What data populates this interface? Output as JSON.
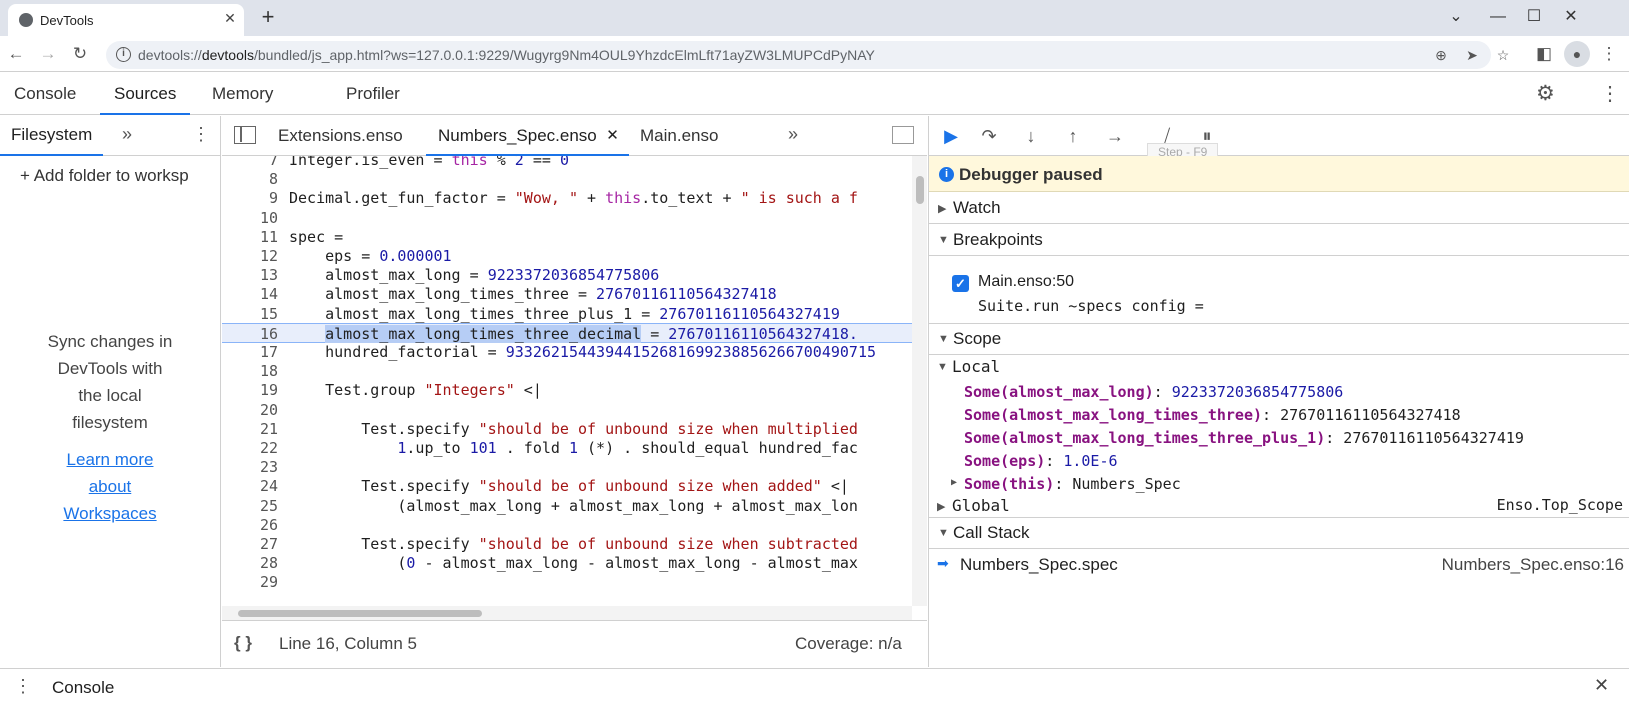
{
  "browser": {
    "tab_title": "DevTools",
    "url_scheme": "devtools://",
    "url_host": "devtools",
    "url_path": "/bundled/js_app.html?ws=127.0.0.1:9229/Wugyrg9Nm4OUL9YhzdcElmLft71ayZW3LMUPCdPyNAY"
  },
  "devtools_tabs": [
    "Console",
    "Sources",
    "Memory",
    "Profiler"
  ],
  "navigator": {
    "tab": "Filesystem",
    "add_folder": "Add folder to worksp",
    "sync_text": [
      "Sync changes in",
      "DevTools with",
      "the local",
      "filesystem"
    ],
    "learn_more": [
      "Learn more",
      "about",
      "Workspaces"
    ]
  },
  "editor": {
    "tabs": [
      "Extensions.enso",
      "Numbers_Spec.enso",
      "Main.enso"
    ],
    "status_position": "Line 16, Column 5",
    "coverage": "Coverage: n/a",
    "lines": [
      {
        "n": "7",
        "tokens": [
          [
            "t",
            "Integer.is_even = "
          ],
          [
            "k",
            "this"
          ],
          [
            "t",
            " % "
          ],
          [
            "n",
            "2"
          ],
          [
            "t",
            " == "
          ],
          [
            "n",
            "0"
          ]
        ]
      },
      {
        "n": "8",
        "tokens": []
      },
      {
        "n": "9",
        "tokens": [
          [
            "t",
            "Decimal.get_fun_factor = "
          ],
          [
            "s",
            "\"Wow, \""
          ],
          [
            "t",
            " + "
          ],
          [
            "k",
            "this"
          ],
          [
            "t",
            ".to_text + "
          ],
          [
            "s",
            "\" is such a f"
          ]
        ]
      },
      {
        "n": "10",
        "tokens": []
      },
      {
        "n": "11",
        "tokens": [
          [
            "t",
            "spec ="
          ]
        ]
      },
      {
        "n": "12",
        "tokens": [
          [
            "t",
            "    eps = "
          ],
          [
            "n",
            "0.000001"
          ]
        ]
      },
      {
        "n": "13",
        "tokens": [
          [
            "t",
            "    almost_max_long = "
          ],
          [
            "n",
            "9223372036854775806"
          ]
        ]
      },
      {
        "n": "14",
        "tokens": [
          [
            "t",
            "    almost_max_long_times_three = "
          ],
          [
            "n",
            "27670116110564327418"
          ]
        ]
      },
      {
        "n": "15",
        "tokens": [
          [
            "t",
            "    almost_max_long_times_three_plus_1 = "
          ],
          [
            "n",
            "27670116110564327419"
          ]
        ]
      },
      {
        "n": "16",
        "tokens": [
          [
            "t",
            "    "
          ],
          [
            "sel",
            "almost_max_long_times_three_decimal"
          ],
          [
            "t",
            " = "
          ],
          [
            "n",
            "27670116110564327418."
          ]
        ]
      },
      {
        "n": "17",
        "tokens": [
          [
            "t",
            "    hundred_factorial = "
          ],
          [
            "n",
            "93326215443944152681699238856266700490715"
          ]
        ]
      },
      {
        "n": "18",
        "tokens": []
      },
      {
        "n": "19",
        "tokens": [
          [
            "t",
            "    Test.group "
          ],
          [
            "s",
            "\"Integers\""
          ],
          [
            "t",
            " <|"
          ]
        ]
      },
      {
        "n": "20",
        "tokens": []
      },
      {
        "n": "21",
        "tokens": [
          [
            "t",
            "        Test.specify "
          ],
          [
            "s",
            "\"should be of unbound size when multiplied"
          ]
        ]
      },
      {
        "n": "22",
        "tokens": [
          [
            "t",
            "            "
          ],
          [
            "n",
            "1"
          ],
          [
            "t",
            ".up_to "
          ],
          [
            "n",
            "101"
          ],
          [
            "t",
            " . fold "
          ],
          [
            "n",
            "1"
          ],
          [
            "t",
            " (*) . should_equal hundred_fac"
          ]
        ]
      },
      {
        "n": "23",
        "tokens": []
      },
      {
        "n": "24",
        "tokens": [
          [
            "t",
            "        Test.specify "
          ],
          [
            "s",
            "\"should be of unbound size when added\""
          ],
          [
            "t",
            " <|"
          ]
        ]
      },
      {
        "n": "25",
        "tokens": [
          [
            "t",
            "            (almost_max_long + almost_max_long + almost_max_lon"
          ]
        ]
      },
      {
        "n": "26",
        "tokens": []
      },
      {
        "n": "27",
        "tokens": [
          [
            "t",
            "        Test.specify "
          ],
          [
            "s",
            "\"should be of unbound size when subtracted"
          ]
        ]
      },
      {
        "n": "28",
        "tokens": [
          [
            "t",
            "            ("
          ],
          [
            "n",
            "0"
          ],
          [
            "t",
            " - almost_max_long - almost_max_long - almost_max"
          ]
        ]
      },
      {
        "n": "29",
        "tokens": []
      }
    ]
  },
  "debugger": {
    "tooltip": "Step - F9",
    "paused": "Debugger paused",
    "watch": "Watch",
    "breakpoints": "Breakpoints",
    "breakpoint_location": "Main.enso:50",
    "breakpoint_code": "Suite.run ~specs config =",
    "scope": "Scope",
    "local": "Local",
    "scope_vars": [
      {
        "name": "Some(almost_max_long)",
        "value": "9223372036854775806",
        "kind": "num"
      },
      {
        "name": "Some(almost_max_long_times_three)",
        "value": "27670116110564327418",
        "kind": "plain"
      },
      {
        "name": "Some(almost_max_long_times_three_plus_1)",
        "value": "27670116110564327419",
        "kind": "plain"
      },
      {
        "name": "Some(eps)",
        "value": "1.0E-6",
        "kind": "num"
      },
      {
        "name": "Some(this)",
        "value": "Numbers_Spec",
        "kind": "plain",
        "expandable": true
      }
    ],
    "global": "Global",
    "global_value": "Enso.Top_Scope",
    "call_stack": "Call Stack",
    "frame_name": "Numbers_Spec.spec",
    "frame_location": "Numbers_Spec.enso:16"
  },
  "drawer": {
    "title": "Console"
  }
}
